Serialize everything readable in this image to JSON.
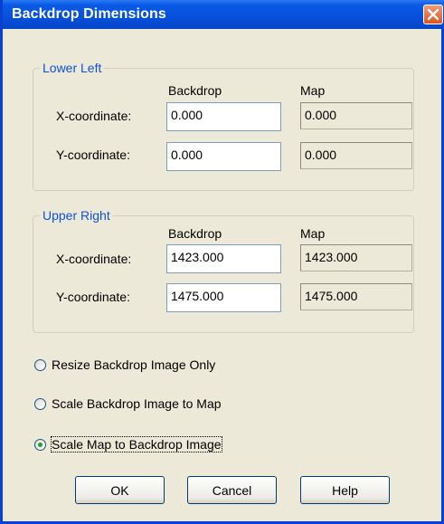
{
  "window": {
    "title": "Backdrop Dimensions"
  },
  "lower_left": {
    "legend": "Lower Left",
    "col_backdrop": "Backdrop",
    "col_map": "Map",
    "x_label": "X-coordinate:",
    "y_label": "Y-coordinate:",
    "x_backdrop": "0.000",
    "x_map": "0.000",
    "y_backdrop": "0.000",
    "y_map": "0.000"
  },
  "upper_right": {
    "legend": "Upper Right",
    "col_backdrop": "Backdrop",
    "col_map": "Map",
    "x_label": "X-coordinate:",
    "y_label": "Y-coordinate:",
    "x_backdrop": "1423.000",
    "x_map": "1423.000",
    "y_backdrop": "1475.000",
    "y_map": "1475.000"
  },
  "options": {
    "resize_only": "Resize Backdrop Image Only",
    "scale_to_map": "Scale Backdrop Image to Map",
    "scale_map": "Scale Map to Backdrop Image",
    "selected": "scale_map"
  },
  "buttons": {
    "ok": "OK",
    "cancel": "Cancel",
    "help": "Help"
  }
}
